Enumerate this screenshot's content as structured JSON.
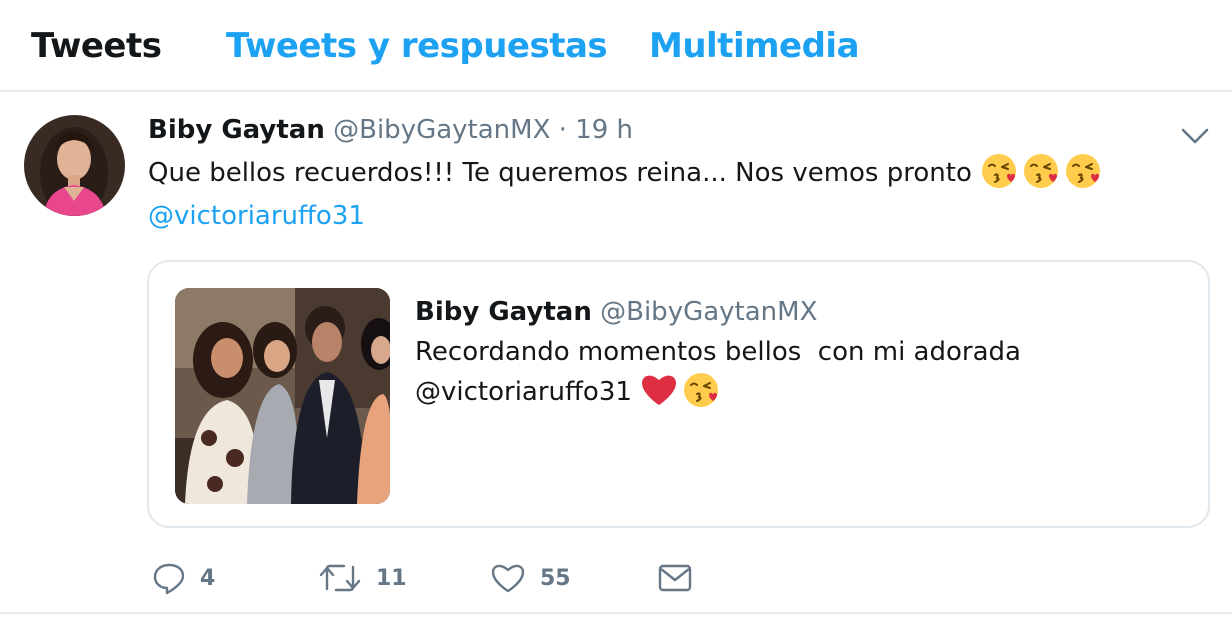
{
  "tabs": {
    "tweets": "Tweets",
    "tweets_replies": "Tweets y respuestas",
    "media": "Multimedia"
  },
  "tweet": {
    "name": "Biby Gaytan",
    "handle": "@BibyGaytanMX",
    "separator": "·",
    "time": "19 h",
    "text": "Que bellos recuerdos!!! Te queremos reina... Nos vemos pronto",
    "emojis": [
      "kissing-face-with-heart-emoji",
      "kissing-face-with-heart-emoji",
      "kissing-face-with-heart-emoji"
    ],
    "mention": "@victoriaruffo31",
    "quoted": {
      "name": "Biby Gaytan",
      "handle": "@BibyGaytanMX",
      "text": "Recordando momentos bellos  con mi adorada",
      "mention": "@victoriaruffo31",
      "emojis": [
        "red-heart-emoji",
        "kissing-face-with-heart-emoji"
      ]
    },
    "actions": {
      "reply_count": "4",
      "retweet_count": "11",
      "like_count": "55"
    }
  },
  "colors": {
    "accent": "#1da1f2",
    "text": "#14171a",
    "secondary": "#657786",
    "border": "#e6ecf0"
  },
  "icons": [
    "chevron-down-icon",
    "reply-icon",
    "retweet-icon",
    "like-icon",
    "direct-message-icon"
  ]
}
